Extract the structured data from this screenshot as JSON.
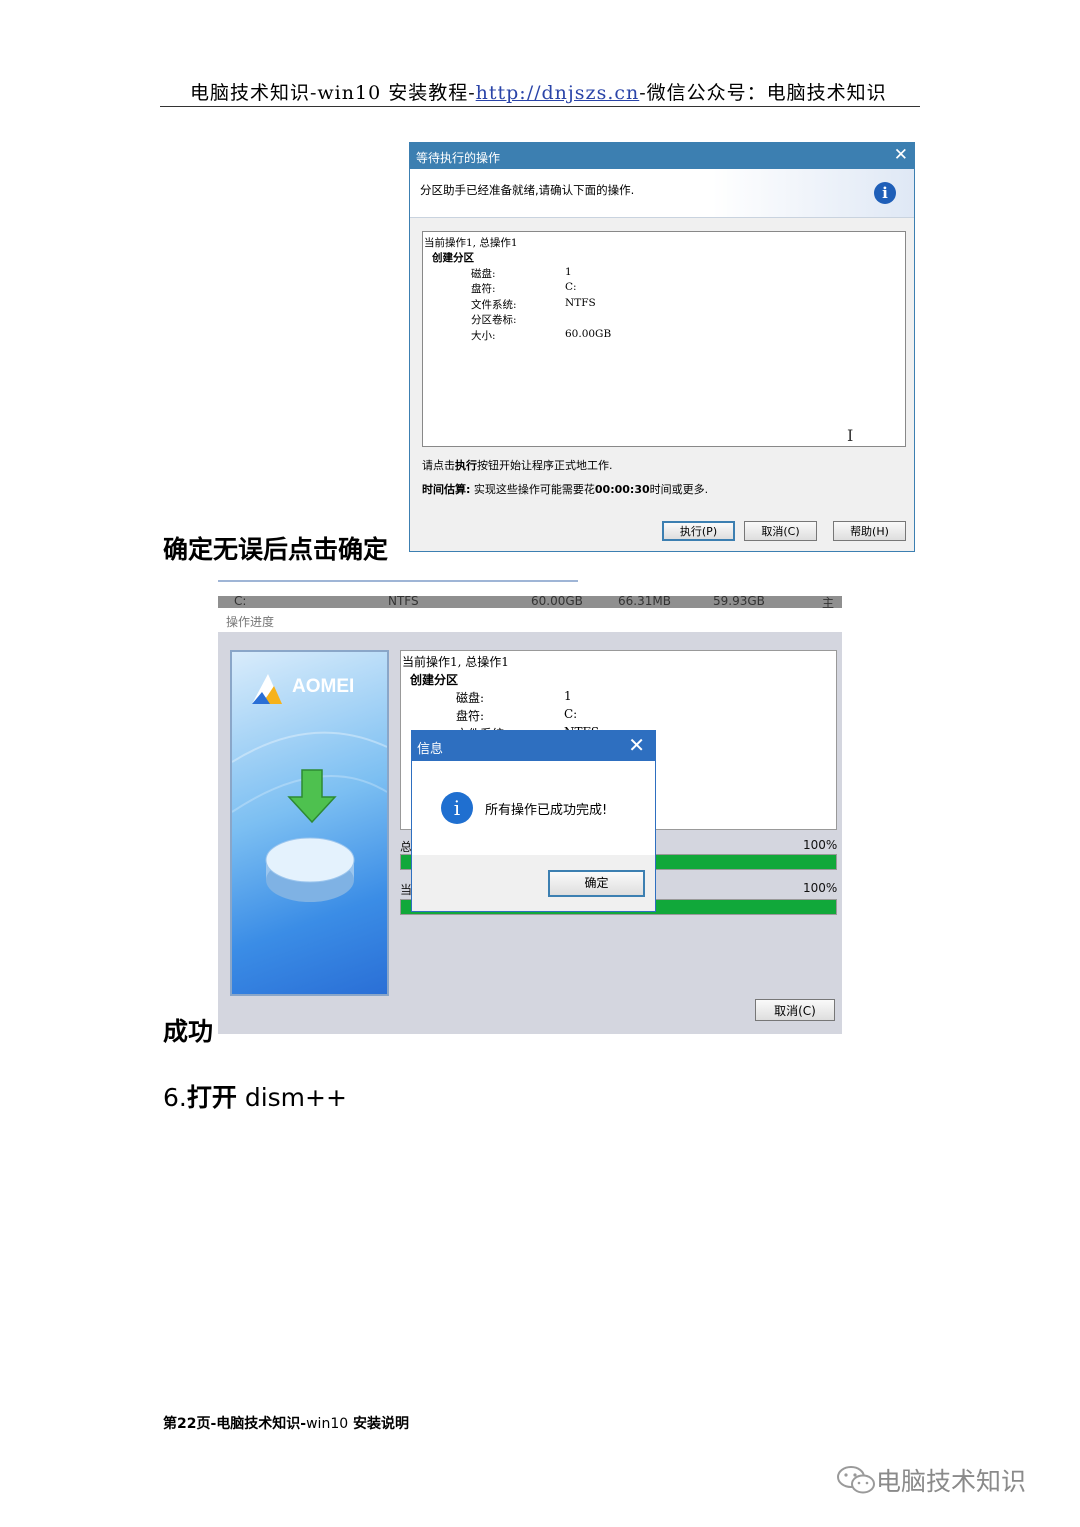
{
  "header": {
    "text_before": "电脑技术知识-win10 安装教程-",
    "link": "http://dnjszs.cn",
    "text_after": "-微信公众号：电脑技术知识"
  },
  "dialog1": {
    "title": "等待执行的操作",
    "close": "✕",
    "intro": "分区助手已经准备就绪,请确认下面的操作.",
    "info_icon": "i",
    "ops": {
      "summary": "当前操作1, 总操作1",
      "heading": "创建分区",
      "rows": [
        {
          "label": "磁盘:",
          "value": "1"
        },
        {
          "label": "盘符:",
          "value": "C:"
        },
        {
          "label": "文件系统:",
          "value": "NTFS"
        },
        {
          "label": "分区卷标:",
          "value": ""
        },
        {
          "label": "大小:",
          "value": "60.00GB"
        }
      ]
    },
    "hint": {
      "pre": "请点击",
      "bold": "执行",
      "post": "按钮开始让程序正式地工作."
    },
    "estimate": {
      "label": "时间估算:",
      "pre": " 实现这些操作可能需要花",
      "time": "00:00:30",
      "post": "时间或更多."
    },
    "buttons": {
      "execute": "执行(P)",
      "cancel": "取消(C)",
      "help": "帮助(H)"
    }
  },
  "caption1": "确定无误后点击确定",
  "screenshot2": {
    "strip": [
      "C:",
      "NTFS",
      "60.00GB",
      "66.31MB",
      "59.93GB",
      "主"
    ],
    "window_title": "操作进度",
    "brand": "AOMEI",
    "list": {
      "summary": "当前操作1, 总操作1",
      "heading": "创建分区",
      "rows": [
        {
          "label": "磁盘:",
          "value": "1"
        },
        {
          "label": "盘符:",
          "value": "C:"
        },
        {
          "label": "文件系统:",
          "value": "NTFS"
        }
      ]
    },
    "total_label": "总",
    "current_label": "当",
    "total_pct": "100%",
    "current_pct": "100%",
    "total_progress": 1.0,
    "current_progress": 1.0,
    "cancel_button": "取消(C)",
    "info_dialog": {
      "title": "信息",
      "close": "✕",
      "icon": "i",
      "message": "所有操作已成功完成!",
      "ok": "确定"
    }
  },
  "caption2": "成功",
  "section6": {
    "number": "6.",
    "bold": "打开",
    "rest": " dism++"
  },
  "footer": {
    "page": "第22页",
    "text": "-电脑技术知识-",
    "version": "win10",
    "tail": " 安装说明"
  },
  "watermark": {
    "text": "电脑技术知识",
    "icon": "wechat-icon"
  }
}
